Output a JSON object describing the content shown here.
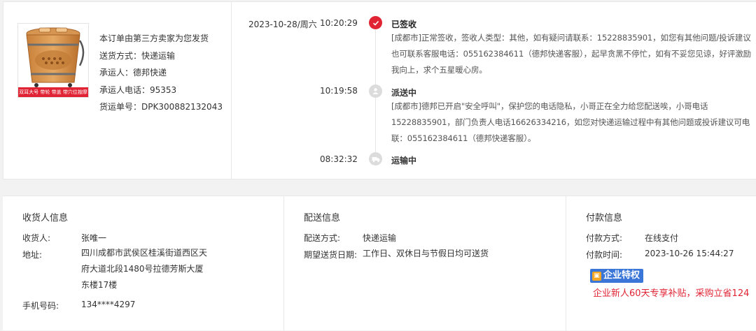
{
  "product": {
    "banner_text": "双耳大号 带轮 带盖 带穴位按摩",
    "lines": [
      "本订单由第三方卖家为您发货",
      "送货方式：快递运输",
      "承运人：德邦快递",
      "承运人电话：95353",
      "货运单号：DPK300882132043"
    ]
  },
  "timeline": {
    "date": "2023-10-28/周六",
    "events": [
      {
        "time": "10:20:29",
        "status": "已签收",
        "icon": "check-icon",
        "text": "[成都市]正常签收，签收人类型：其他，如有疑问请联系：15228835901，如您有其他问题/投诉建议也可联系客服电话：055162384611（德邦快递客服），起早贪黑不停忙，如有不妥您见谅，好评激励我向上，求个五星暖心房。"
      },
      {
        "time": "10:19:58",
        "status": "派送中",
        "icon": "delivery-person-icon",
        "text": "[成都市]德邦已开启\"安全呼叫\"，保护您的电话隐私，小哥正在全力给您配送唉，小哥电话15228835901，部门负责人电话16626334216，如您对快递运输过程中有其他问题或投诉建议可电联：055162384611（德邦快递客服）。"
      },
      {
        "time": "08:32:32",
        "status": "运输中",
        "icon": "truck-icon",
        "text": ""
      }
    ]
  },
  "consignee": {
    "title": "收货人信息",
    "name_label": "收货人:",
    "name": "张唯一",
    "address_label": "地址:",
    "address": "四川成都市武侯区桂溪街道西区天府大道北段1480号拉德芳斯大厦东楼17楼",
    "phone_label": "手机号码:",
    "phone": "134****4297"
  },
  "delivery": {
    "title": "配送信息",
    "method_label": "配送方式:",
    "method": "快递运输",
    "date_label": "期望送货日期:",
    "date": "工作日、双休日与节假日均可送货"
  },
  "payment": {
    "title": "付款信息",
    "method_label": "付款方式:",
    "method": "在线支付",
    "time_label": "付款时间:",
    "time": "2023-10-26 15:44:27",
    "badge": "企业特权",
    "promo": "企业新人60天专享补贴，采购立省124"
  },
  "colors": {
    "accent": "#e02434",
    "badge_blue": "#3a76d8"
  }
}
